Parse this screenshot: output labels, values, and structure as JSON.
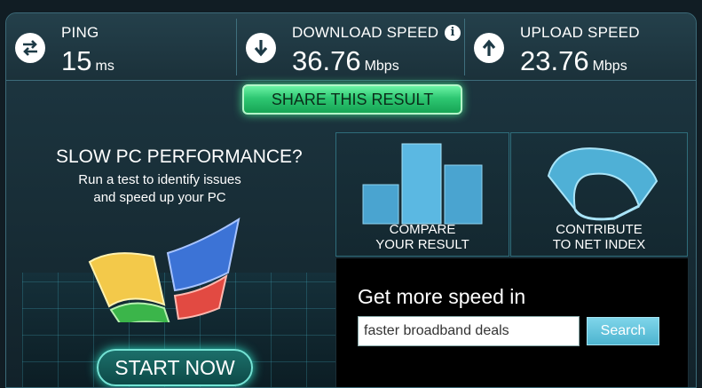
{
  "stats": {
    "ping": {
      "label": "PING",
      "value": "15",
      "unit": "ms",
      "icon": "swap-arrows-icon"
    },
    "download": {
      "label": "DOWNLOAD SPEED",
      "value": "36.76",
      "unit": "Mbps",
      "icon": "download-arrow-icon",
      "info_icon": "info-icon"
    },
    "upload": {
      "label": "UPLOAD SPEED",
      "value": "23.76",
      "unit": "Mbps",
      "icon": "upload-arrow-icon"
    }
  },
  "share_button": "SHARE THIS RESULT",
  "promo": {
    "title": "SLOW PC PERFORMANCE?",
    "subtitle_line1": "Run a test to identify issues",
    "subtitle_line2": "and speed up your PC",
    "button": "START NOW"
  },
  "compare": {
    "line1": "COMPARE",
    "line2": "YOUR RESULT"
  },
  "contribute": {
    "line1": "CONTRIBUTE",
    "line2": "TO NET INDEX"
  },
  "ad": {
    "title": "Get more speed in",
    "input_value": "faster broadband deals",
    "search_button": "Search"
  },
  "colors": {
    "share_green": "#2ec772",
    "accent_cyan": "#4db4cf",
    "start_teal": "#74e2d4"
  }
}
